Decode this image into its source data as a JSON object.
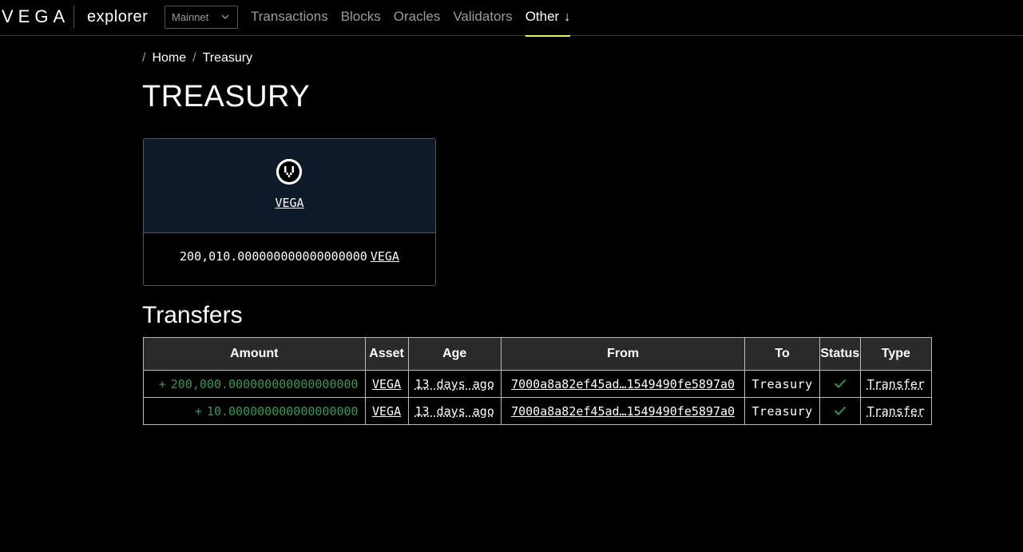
{
  "header": {
    "logo": "VEGA",
    "app_name": "explorer",
    "network_selected": "Mainnet",
    "nav": [
      {
        "label": "Transactions",
        "active": false
      },
      {
        "label": "Blocks",
        "active": false
      },
      {
        "label": "Oracles",
        "active": false
      },
      {
        "label": "Validators",
        "active": false
      },
      {
        "label": "Other",
        "active": true
      }
    ],
    "accent_color": "#d7fb50"
  },
  "breadcrumb": {
    "sep1": "/",
    "home": "Home",
    "sep2": "/",
    "current": "Treasury"
  },
  "page": {
    "title": "TREASURY"
  },
  "asset_card": {
    "icon": "vega-token-icon",
    "asset_name": "VEGA",
    "balance": "200,010.000000000000000000",
    "balance_unit": "VEGA"
  },
  "transfers": {
    "title": "Transfers",
    "columns": [
      "Amount",
      "Asset",
      "Age",
      "From",
      "To",
      "Status",
      "Type"
    ],
    "rows": [
      {
        "sign": "+",
        "amount": "200,000.000000000000000000",
        "asset": "VEGA",
        "age": "13 days ago",
        "from": "7000a8a82ef45ad…1549490fe5897a0",
        "to": "Treasury",
        "status": "check-icon",
        "type": "Transfer"
      },
      {
        "sign": "+",
        "amount": "10.000000000000000000",
        "asset": "VEGA",
        "age": "13 days ago",
        "from": "7000a8a82ef45ad…1549490fe5897a0",
        "to": "Treasury",
        "status": "check-icon",
        "type": "Transfer"
      }
    ],
    "positive_color": "#2f9a52"
  }
}
